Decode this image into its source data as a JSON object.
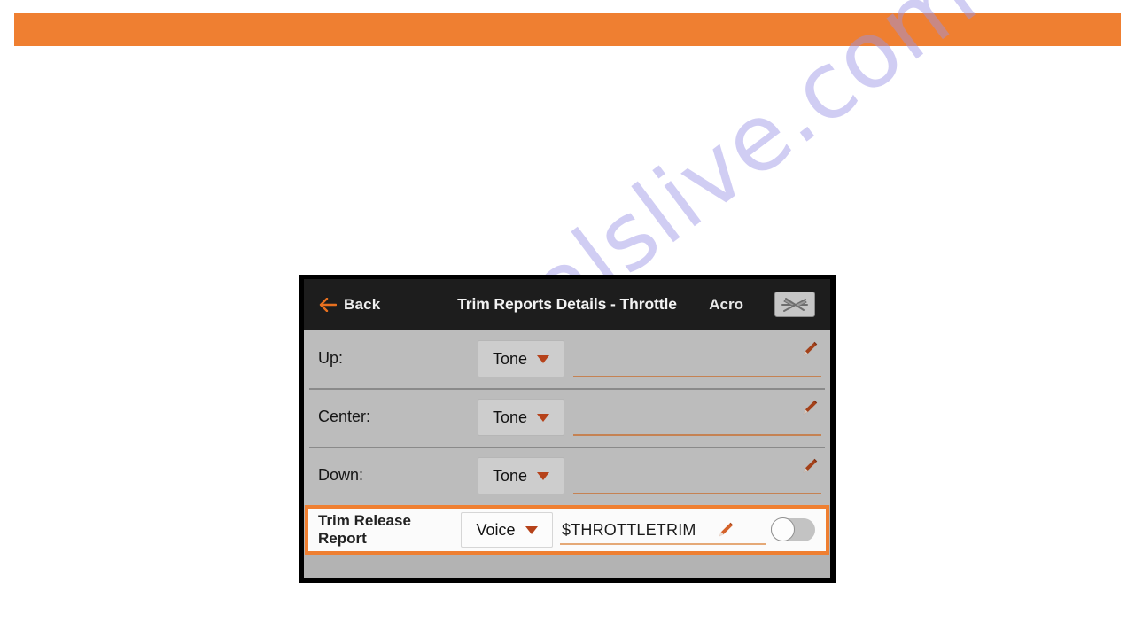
{
  "page": {
    "background_color": "#ffffff",
    "banner_color": "#ef7f31",
    "watermark": "manualslive.com",
    "watermark_color": "#9b93e6"
  },
  "device": {
    "header": {
      "back_label": "Back",
      "back_icon": "arrow-left-icon",
      "title": "Trim Reports Details - Throttle",
      "mode_label": "Acro",
      "model_icon": "airplane-icon",
      "background_color": "#1d1d1d",
      "accent_color": "#ef7f31"
    },
    "rows": [
      {
        "label": "Up:",
        "select_value": "Tone",
        "field_value": "",
        "edit_icon": "pencil-icon",
        "has_toggle": false,
        "highlighted": false
      },
      {
        "label": "Center:",
        "select_value": "Tone",
        "field_value": "",
        "edit_icon": "pencil-icon",
        "has_toggle": false,
        "highlighted": false
      },
      {
        "label": "Down:",
        "select_value": "Tone",
        "field_value": "",
        "edit_icon": "pencil-icon",
        "has_toggle": false,
        "highlighted": false
      }
    ],
    "trim_release_row": {
      "label": "Trim Release Report",
      "select_value": "Voice",
      "field_value": "$THROTTLETRIM",
      "edit_icon": "pencil-icon",
      "toggle_state": "off",
      "highlight_color": "#ef7f31"
    }
  }
}
